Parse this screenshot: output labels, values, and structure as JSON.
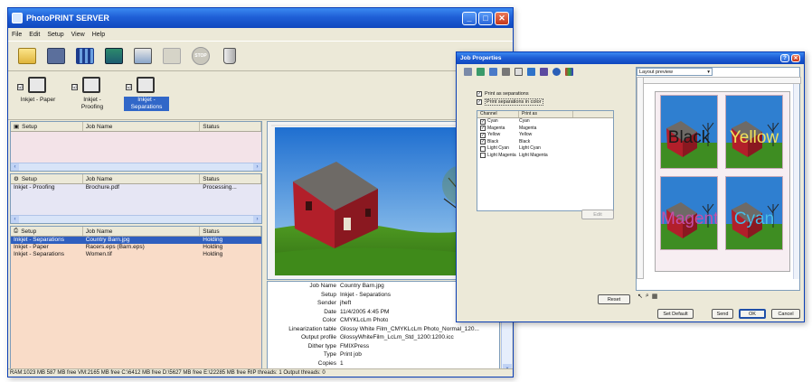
{
  "main_window": {
    "title": "PhotoPRINT SERVER",
    "menu": [
      "File",
      "Edit",
      "Setup",
      "View",
      "Help"
    ],
    "toolbar_icons": [
      "folder-icon",
      "save-icon",
      "color-grid-icon",
      "printer-setup-icon",
      "printer-icon",
      "printer-disabled-icon",
      "stop-icon",
      "trash-icon"
    ],
    "stop_label": "STOP",
    "quick_sets": [
      {
        "label": "Inkjet - Paper",
        "checked": true,
        "selected": false
      },
      {
        "label": "Inkjet -\nProofing",
        "checked": true,
        "selected": false
      },
      {
        "label": "Inkjet -\nSeparations",
        "checked": true,
        "selected": true
      }
    ],
    "queues": [
      {
        "name": "hold-queue",
        "headers": [
          "Setup",
          "Job Name",
          "Status"
        ],
        "rows": []
      },
      {
        "name": "processing-queue",
        "headers": [
          "Setup",
          "Job Name",
          "Status"
        ],
        "rows": [
          {
            "setup": "Inkjet - Proofing",
            "job": "Brochure.pdf",
            "status": "Processing..."
          }
        ]
      },
      {
        "name": "print-queue",
        "headers": [
          "Setup",
          "Job Name",
          "Status"
        ],
        "rows": [
          {
            "setup": "Inkjet - Separations",
            "job": "Country Barn.jpg",
            "status": "Holding"
          },
          {
            "setup": "Inkjet - Paper",
            "job": "Racers.eps (Barn.eps)",
            "status": "Holding"
          },
          {
            "setup": "Inkjet - Separations",
            "job": "Women.tif",
            "status": "Holding"
          }
        ]
      }
    ],
    "job_info": [
      {
        "k": "Job Name",
        "v": "Country Barn.jpg"
      },
      {
        "k": "Setup",
        "v": "Inkjet - Separations"
      },
      {
        "k": "Sender",
        "v": "jheft"
      },
      {
        "k": "Date",
        "v": "11/4/2005 4:45 PM"
      },
      {
        "k": "Color",
        "v": "CMYKLcLm Photo"
      },
      {
        "k": "Linearization table",
        "v": "Glossy White Film_CMYKLcLm Photo_Normal_120..."
      },
      {
        "k": "Output profile",
        "v": "GlossyWhiteFilm_LcLm_Std_1200:1200.icc"
      },
      {
        "k": "Dither type",
        "v": "FMIXPress"
      },
      {
        "k": "Type",
        "v": "Print job"
      },
      {
        "k": "Copies",
        "v": "1"
      }
    ],
    "status_bar": "RAM:1023 MB 587 MB free VM:2165 MB free C:\\6412 MB free D:\\5627 MB free E:\\22285 MB free RIP threads: 1 Output threads: 0"
  },
  "dialog": {
    "title": "Job Properties",
    "checkboxes": [
      {
        "label": "Print as separations",
        "checked": true
      },
      {
        "label": "Print separations in color",
        "checked": true
      }
    ],
    "channel_headers": [
      "Channel",
      "Print as"
    ],
    "channels": [
      {
        "name": "Cyan",
        "print_as": "Cyan",
        "checked": true
      },
      {
        "name": "Magenta",
        "print_as": "Magenta",
        "checked": true
      },
      {
        "name": "Yellow",
        "print_as": "Yellow",
        "checked": true
      },
      {
        "name": "Black",
        "print_as": "Black",
        "checked": true
      },
      {
        "name": "Light Cyan",
        "print_as": "Light Cyan",
        "checked": false
      },
      {
        "name": "Light Magenta",
        "print_as": "Light Magenta",
        "checked": false
      }
    ],
    "edit_button": "Edit",
    "reset_button": "Reset",
    "layout_select": "Layout preview",
    "tiles": [
      {
        "label": "Black",
        "color": "#1a1a1a"
      },
      {
        "label": "Yellow",
        "color": "#f2e35a"
      },
      {
        "label": "Magenta",
        "color": "#c24fa8"
      },
      {
        "label": "Cyan",
        "color": "#46bde8"
      }
    ],
    "buttons": {
      "set_default": "Set Default",
      "send": "Send",
      "ok": "OK",
      "cancel": "Cancel"
    }
  },
  "colors": {
    "titlebar": "#1f5fd6",
    "hold_bg": "#f3e3e8",
    "processing_bg": "#e6e6f4",
    "print_bg": "#f9dcc8",
    "selection": "#2f5fbf"
  }
}
